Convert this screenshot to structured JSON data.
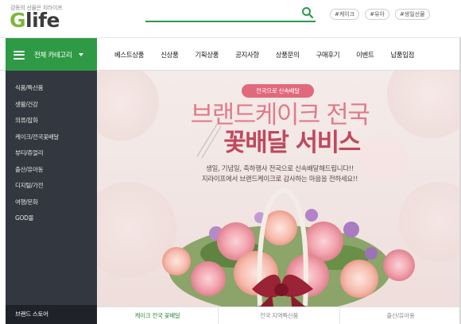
{
  "header": {
    "tagline": "감동의 선물은 지라이프",
    "logo_g": "G",
    "logo_rest": "life",
    "search_placeholder": "",
    "tags": [
      "#케이크",
      "#유아",
      "#생일선물"
    ]
  },
  "nav": {
    "all_categories": "전체 카테고리",
    "menu": [
      "베스트상품",
      "신상품",
      "기획상품",
      "공지사항",
      "상품문의",
      "구매후기",
      "이벤트",
      "납품입점"
    ]
  },
  "sidebar": {
    "items": [
      "식품/특산품",
      "생활/건강",
      "의류/잡화",
      "케이크/전국꽃배달",
      "뷰티/쥬얼리",
      "출산/유아동",
      "디지털/가전",
      "여행/문화",
      "GOD몰"
    ],
    "bottom": "브랜드 스토어"
  },
  "banner": {
    "pill": "전국으로 신속배달",
    "title_line1": "브랜드케이크 전국",
    "title_line2": "꽃배달 서비스",
    "desc_line1": "생일, 기념일, 축하행사 전국으로 신속배달해드립니다!!",
    "desc_line2": "지라이프에서 브랜드케이크로 감사하는 마음을 전하세요!!"
  },
  "tabs": [
    {
      "label": "케이크 전국 꽃배달",
      "active": true
    },
    {
      "label": "전국 지역특산품",
      "active": false
    },
    {
      "label": "출산/유아용",
      "active": false
    }
  ],
  "colors": {
    "brand_green": "#2f9a46",
    "logo_green": "#7fb53b",
    "sidebar_dark": "#33373f",
    "banner_pink": "#e06a7c",
    "title_dark_pink": "#c0485d"
  }
}
